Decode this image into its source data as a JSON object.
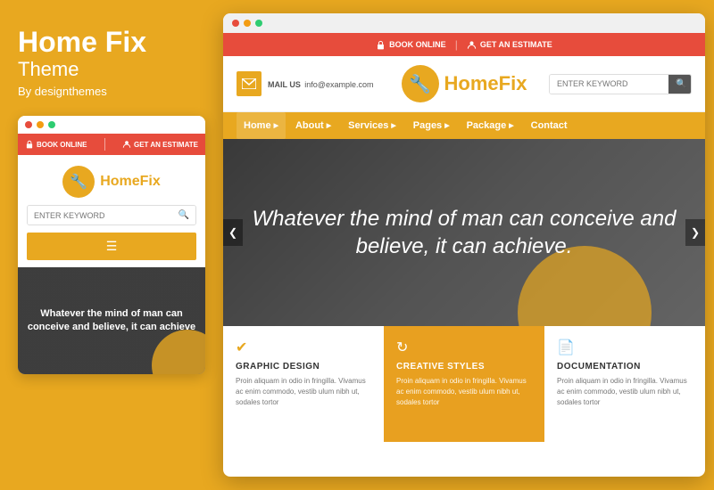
{
  "brand": {
    "title": "Home Fix",
    "subtitle": "Theme",
    "by": "By designthemes"
  },
  "topbar": {
    "book_online": "BOOK ONLINE",
    "get_estimate": "GET AN ESTIMATE",
    "separator": "|"
  },
  "header": {
    "mail_label": "MAIL US",
    "mail_address": "info@example.com",
    "logo_text_part1": "Home",
    "logo_text_part2": "Fix",
    "search_placeholder": "ENTER KEYWORD"
  },
  "nav": {
    "items": [
      {
        "label": "Home",
        "active": true
      },
      {
        "label": "About",
        "active": false
      },
      {
        "label": "Services",
        "active": false
      },
      {
        "label": "Pages",
        "active": false
      },
      {
        "label": "Package",
        "active": false
      },
      {
        "label": "Contact",
        "active": false
      }
    ]
  },
  "hero": {
    "text": "Whatever the mind of man can conceive and believe, it can achieve."
  },
  "cards": [
    {
      "icon": "✔",
      "title": "GRAPHIC DESIGN",
      "text": "Proin aliquam in odio in fringilla. Vivamus ac enim commodo, vestib ulum nibh ut, sodales tortor"
    },
    {
      "icon": "↻",
      "title": "CREATIVE STYLES",
      "text": "Proin aliquam in odio in fringilla. Vivamus ac enim commodo, vestib ulum nibh ut, sodales tortor"
    },
    {
      "icon": "📄",
      "title": "DOCUMENTATION",
      "text": "Proin aliquam in odio in fringilla. Vivamus ac enim commodo, vestib ulum nibh ut, sodales tortor"
    }
  ],
  "mobile": {
    "hero_text": "Whatever the mind of man can conceive and believe, it can achieve",
    "search_placeholder": "ENTER KEYWORD"
  },
  "dots": {
    "colors": [
      "#e74c3c",
      "#f39c12",
      "#2ecc71"
    ]
  }
}
